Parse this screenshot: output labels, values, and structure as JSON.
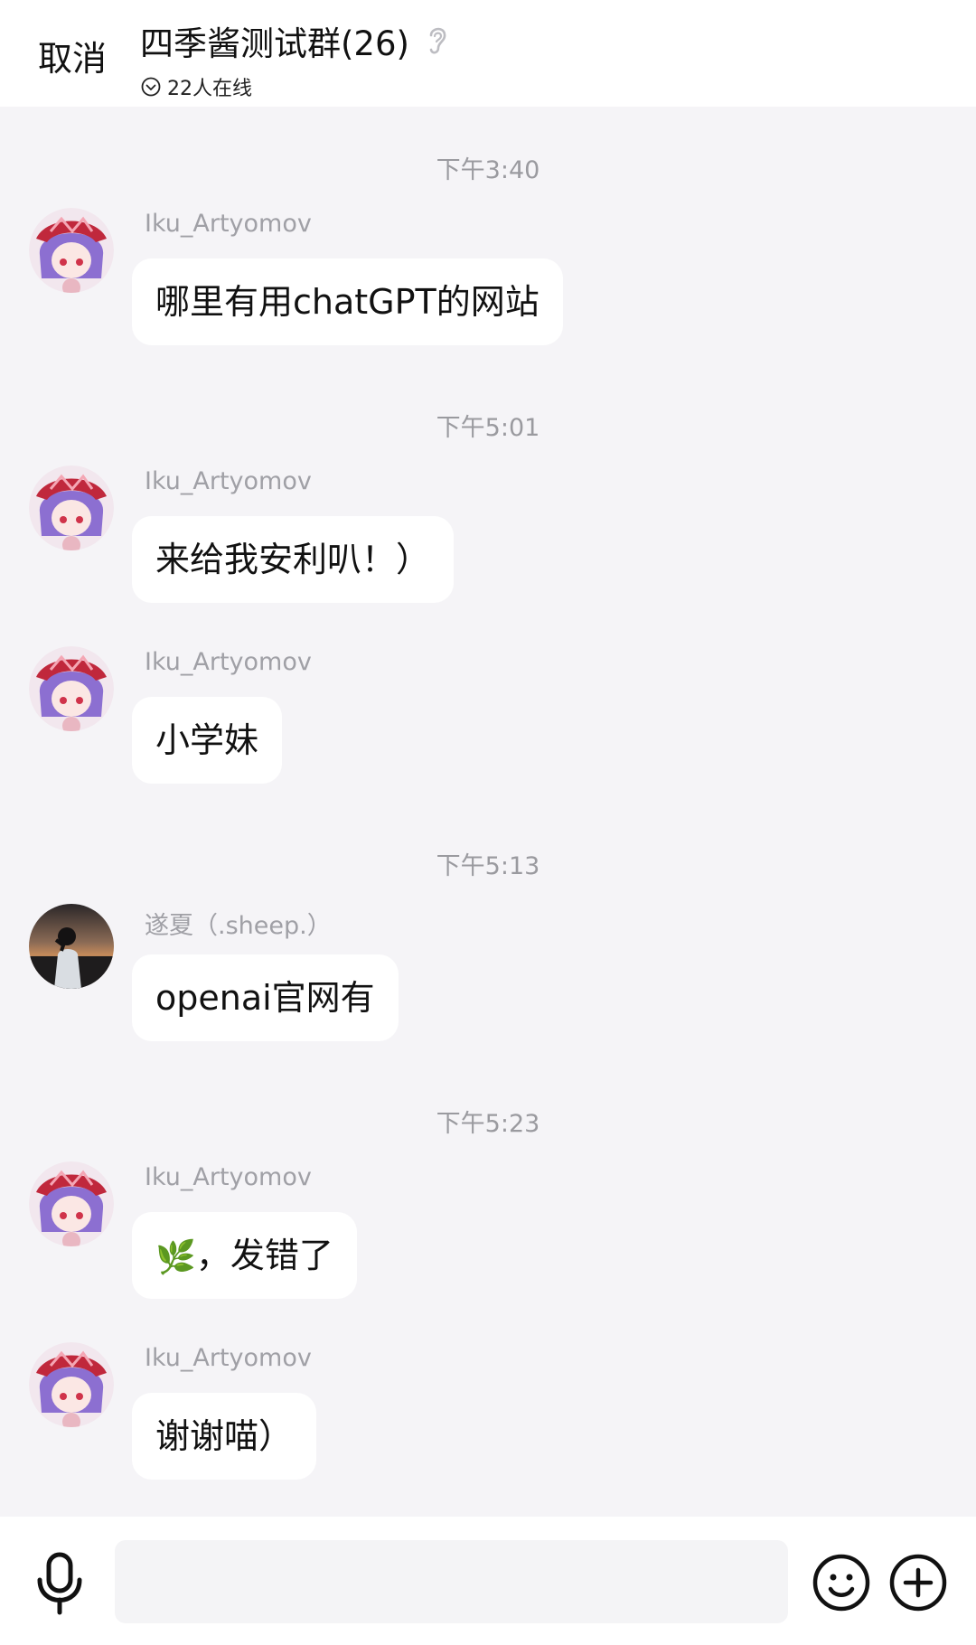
{
  "header": {
    "cancel_label": "取消",
    "title": "四季酱测试群(26)",
    "online_status": "22人在线"
  },
  "messages": [
    {
      "kind": "time",
      "text": "下午3:40"
    },
    {
      "kind": "msg",
      "sender": "Iku_Artyomov",
      "text": "哪里有用chatGPT的网站",
      "avatar": "anime-avatar-icon"
    },
    {
      "kind": "time",
      "text": "下午5:01"
    },
    {
      "kind": "msg",
      "sender": "Iku_Artyomov",
      "text": "来给我安利叭！）",
      "avatar": "anime-avatar-icon"
    },
    {
      "kind": "msg",
      "sender": "Iku_Artyomov",
      "text": "小学妹",
      "avatar": "anime-avatar-icon"
    },
    {
      "kind": "time",
      "text": "下午5:13"
    },
    {
      "kind": "msg",
      "sender": "遂夏（.sheep.）",
      "text": "openai官网有",
      "avatar": "photo-avatar-icon"
    },
    {
      "kind": "time",
      "text": "下午5:23"
    },
    {
      "kind": "msg",
      "sender": "Iku_Artyomov",
      "emoji": "🌿",
      "text": "，发错了",
      "avatar": "anime-avatar-icon"
    },
    {
      "kind": "msg",
      "sender": "Iku_Artyomov",
      "text": "谢谢喵）",
      "avatar": "anime-avatar-icon"
    }
  ],
  "input": {
    "placeholder": ""
  },
  "icons": {
    "ear": "ear-icon",
    "online": "check-circle-icon",
    "mic": "microphone-icon",
    "emoji": "smiley-icon",
    "plus": "plus-circle-icon"
  },
  "colors": {
    "background": "#f5f4f7",
    "bubble": "#ffffff",
    "meta_text": "#a0a0a6"
  }
}
